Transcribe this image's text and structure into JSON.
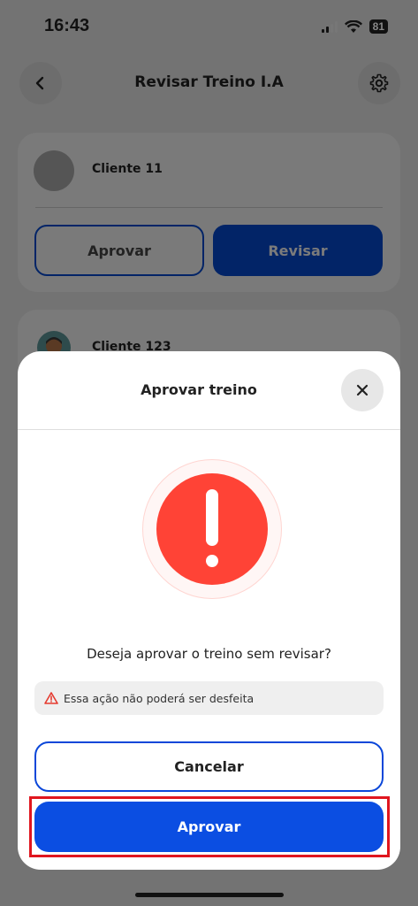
{
  "status_bar": {
    "time": "16:43",
    "battery": "81"
  },
  "header": {
    "title": "Revisar Treino I.A",
    "back_icon": "chevron-left-icon",
    "settings_icon": "gear-icon"
  },
  "cards": [
    {
      "client_name": "Cliente 11",
      "approve_label": "Aprovar",
      "review_label": "Revisar"
    },
    {
      "client_name": "Cliente 123"
    }
  ],
  "modal": {
    "title": "Aprovar treino",
    "question": "Deseja aprovar o treino sem revisar?",
    "warning": "Essa ação não poderá ser desfeita",
    "cancel_label": "Cancelar",
    "approve_label": "Aprovar"
  },
  "colors": {
    "primary_blue": "#0b4ee2",
    "alert_red": "#ff4336",
    "highlight_red": "#e0161f"
  }
}
